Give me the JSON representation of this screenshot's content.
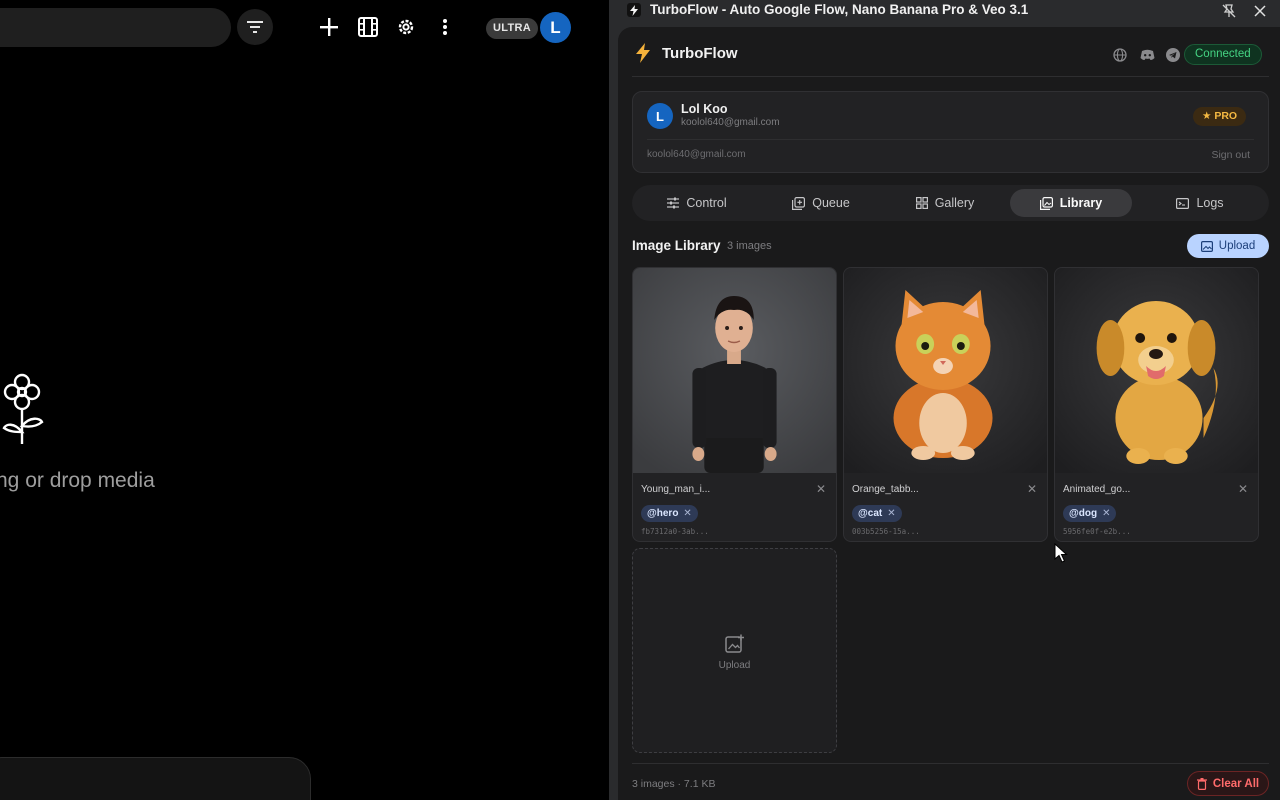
{
  "left_app": {
    "ultra_badge": "ULTRA",
    "avatar_letter": "L",
    "drop_text": "ng or drop media"
  },
  "window": {
    "title": "TurboFlow - Auto Google Flow, Nano Banana Pro & Veo 3.1"
  },
  "header": {
    "brand": "TurboFlow",
    "status": "Connected",
    "icons": [
      "globe-icon",
      "discord-icon",
      "telegram-icon"
    ]
  },
  "account": {
    "avatar_letter": "L",
    "name": "Lol Koo",
    "email": "koolol640@gmail.com",
    "plan": "★ PRO",
    "email_secondary": "koolol640@gmail.com",
    "sign_out": "Sign out"
  },
  "tabs": [
    {
      "label": "Control",
      "active": false
    },
    {
      "label": "Queue",
      "active": false
    },
    {
      "label": "Gallery",
      "active": false
    },
    {
      "label": "Library",
      "active": true
    },
    {
      "label": "Logs",
      "active": false
    }
  ],
  "library": {
    "title": "Image Library",
    "count": "3 images",
    "upload_label": "Upload",
    "images": [
      {
        "filename": "Young_man_i...",
        "tag": "@hero",
        "hash": "fb7312a0-3ab..."
      },
      {
        "filename": "Orange_tabb...",
        "tag": "@cat",
        "hash": "003b5256-15a..."
      },
      {
        "filename": "Animated_go...",
        "tag": "@dog",
        "hash": "5956fe0f-e2b..."
      }
    ],
    "upload_card_label": "Upload"
  },
  "footer": {
    "info": "3 images · 7.1 KB",
    "clear_all": "Clear All"
  },
  "colors": {
    "accent_blue": "#b9d3ff",
    "connected_green": "#45d483",
    "pro_gold": "#f5b942",
    "danger_red": "#ff6b6b"
  }
}
